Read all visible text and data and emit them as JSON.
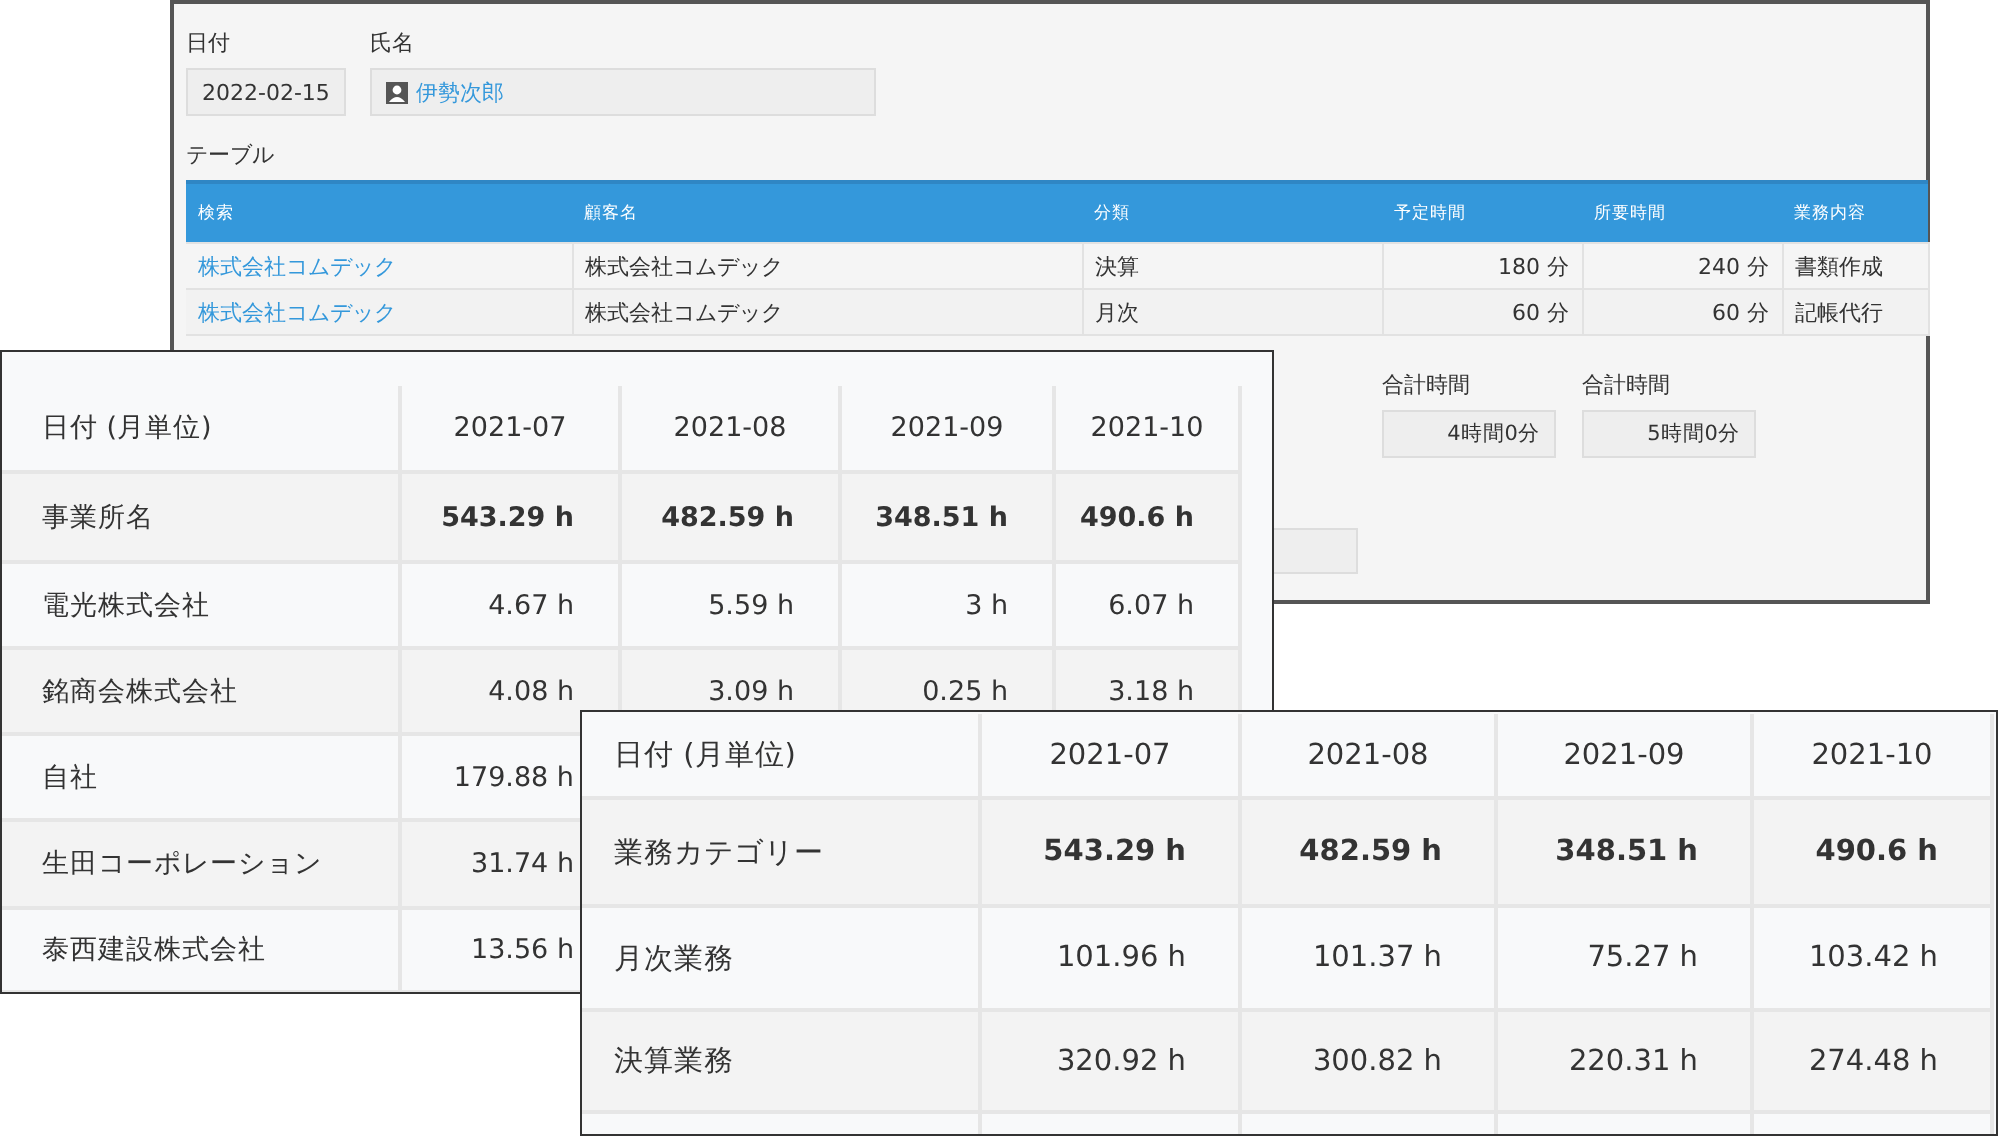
{
  "record_form": {
    "date": {
      "label": "日付",
      "value": "2022-02-15"
    },
    "person": {
      "label": "氏名",
      "value": "伊勢次郎"
    },
    "table": {
      "title": "テーブル",
      "columns": [
        "検索",
        "顧客名",
        "分類",
        "予定時間",
        "所要時間",
        "業務内容"
      ],
      "rows": [
        [
          "株式会社コムデック",
          "株式会社コムデック",
          "決算",
          "180 分",
          "240 分",
          "書類作成"
        ],
        [
          "株式会社コムデック",
          "株式会社コムデック",
          "月次",
          "60 分",
          "60 分",
          "記帳代行"
        ]
      ]
    },
    "totals": [
      {
        "label": "合計時間",
        "value": "4時間0分"
      },
      {
        "label": "合計時間",
        "value": "5時間0分"
      }
    ]
  },
  "office_report": {
    "columns": [
      "日付 (月単位)",
      "2021-07",
      "2021-08",
      "2021-09",
      "2021-10"
    ],
    "rows": [
      {
        "kind": "total",
        "cells": [
          "事業所名",
          "543.29 h",
          "482.59 h",
          "348.51 h",
          "490.6 h"
        ]
      },
      {
        "kind": "item",
        "cells": [
          "電光株式会社",
          "4.67 h",
          "5.59 h",
          "3 h",
          "6.07 h"
        ]
      },
      {
        "kind": "item",
        "cells": [
          "銘商会株式会社",
          "4.08 h",
          "3.09 h",
          "0.25 h",
          "3.18 h"
        ]
      },
      {
        "kind": "item",
        "cells": [
          "自社",
          "179.88 h"
        ]
      },
      {
        "kind": "item",
        "cells": [
          "生田コーポレーション",
          "31.74 h"
        ]
      },
      {
        "kind": "item",
        "cells": [
          "泰西建設株式会社",
          "13.56 h"
        ]
      }
    ]
  },
  "category_report": {
    "columns": [
      "日付 (月単位)",
      "2021-07",
      "2021-08",
      "2021-09",
      "2021-10"
    ],
    "rows": [
      {
        "kind": "total",
        "cells": [
          "業務カテゴリー",
          "543.29 h",
          "482.59 h",
          "348.51 h",
          "490.6 h"
        ]
      },
      {
        "kind": "item",
        "cells": [
          "月次業務",
          "101.96 h",
          "101.37 h",
          "75.27 h",
          "103.42 h"
        ]
      },
      {
        "kind": "item",
        "cells": [
          "決算業務",
          "320.92 h",
          "300.82 h",
          "220.31 h",
          "274.48 h"
        ]
      },
      {
        "kind": "item",
        "cells": []
      }
    ]
  }
}
